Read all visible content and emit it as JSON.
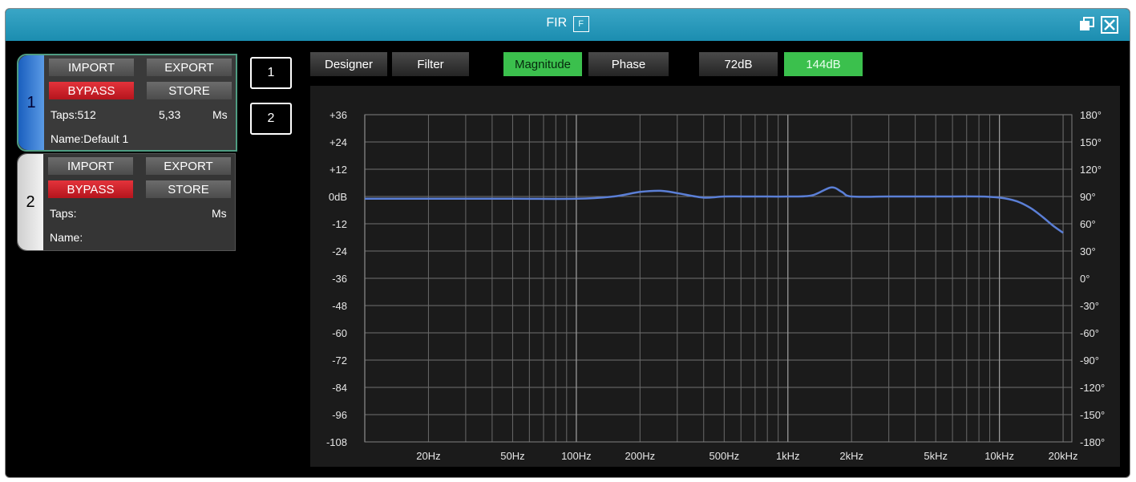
{
  "window": {
    "title": "FIR",
    "title_badge": "F",
    "restore_icon": "restore-window-icon",
    "close_icon": "close-icon"
  },
  "slots": [
    {
      "number": "1",
      "import_label": "IMPORT",
      "export_label": "EXPORT",
      "bypass_label": "BYPASS",
      "store_label": "STORE",
      "taps_text": "Taps:512",
      "time_value": "5,33",
      "time_unit": "Ms",
      "name_text": "Name:Default 1",
      "selected": true
    },
    {
      "number": "2",
      "import_label": "IMPORT",
      "export_label": "EXPORT",
      "bypass_label": "BYPASS",
      "store_label": "STORE",
      "taps_text": "Taps:",
      "time_value": "",
      "time_unit": "Ms",
      "name_text": "Name:",
      "selected": false
    }
  ],
  "channel_buttons": [
    "1",
    "2"
  ],
  "toolbar": {
    "designer_label": "Designer",
    "filter_label": "Filter",
    "magnitude_label": "Magnitude",
    "phase_label": "Phase",
    "range72_label": "72dB",
    "range144_label": "144dB",
    "active_view": "Magnitude",
    "active_range": "144dB"
  },
  "colors": {
    "active_green": "#3bc04d",
    "bypass_red": "#d42a32",
    "curve": "#5b7fd6",
    "titlebar": "#2b9bbd"
  },
  "chart_data": {
    "type": "line",
    "x_scale": "log",
    "xlim": [
      10,
      22000
    ],
    "ylim": [
      -108,
      36
    ],
    "y2lim": [
      -180,
      180
    ],
    "y_ticks": [
      36,
      24,
      12,
      0,
      -12,
      -24,
      -36,
      -48,
      -60,
      -72,
      -84,
      -96,
      -108
    ],
    "y_tick_labels": [
      "+36",
      "+24",
      "+12",
      "0dB",
      "-12",
      "-24",
      "-36",
      "-48",
      "-60",
      "-72",
      "-84",
      "-96",
      "-108"
    ],
    "y2_ticks": [
      180,
      150,
      120,
      90,
      60,
      30,
      0,
      -30,
      -60,
      -90,
      -120,
      -150,
      -180
    ],
    "y2_tick_labels": [
      "180°",
      "150°",
      "120°",
      "90°",
      "60°",
      "30°",
      "0°",
      "-30°",
      "-60°",
      "-90°",
      "-120°",
      "-150°",
      "-180°"
    ],
    "x_tick_values": [
      20,
      50,
      100,
      200,
      500,
      1000,
      2000,
      5000,
      10000,
      20000
    ],
    "x_tick_labels": [
      "20Hz",
      "50Hz",
      "100Hz",
      "200Hz",
      "500Hz",
      "1kHz",
      "2kHz",
      "5kHz",
      "10kHz",
      "20kHz"
    ],
    "grid": true,
    "series": [
      {
        "x": [
          10,
          20,
          50,
          100,
          150,
          200,
          250,
          300,
          400,
          500,
          700,
          1000,
          1300,
          1600,
          1800,
          2000,
          3000,
          5000,
          8000,
          10000,
          12000,
          14000,
          16000,
          18000,
          20000
        ],
        "y": [
          -1,
          -1,
          -1,
          -1,
          0,
          2,
          2.5,
          1.5,
          -0.5,
          0,
          0,
          0,
          0.5,
          4,
          2,
          0,
          0,
          0,
          0,
          -0.5,
          -2,
          -5,
          -9,
          -13,
          -16
        ]
      }
    ]
  }
}
